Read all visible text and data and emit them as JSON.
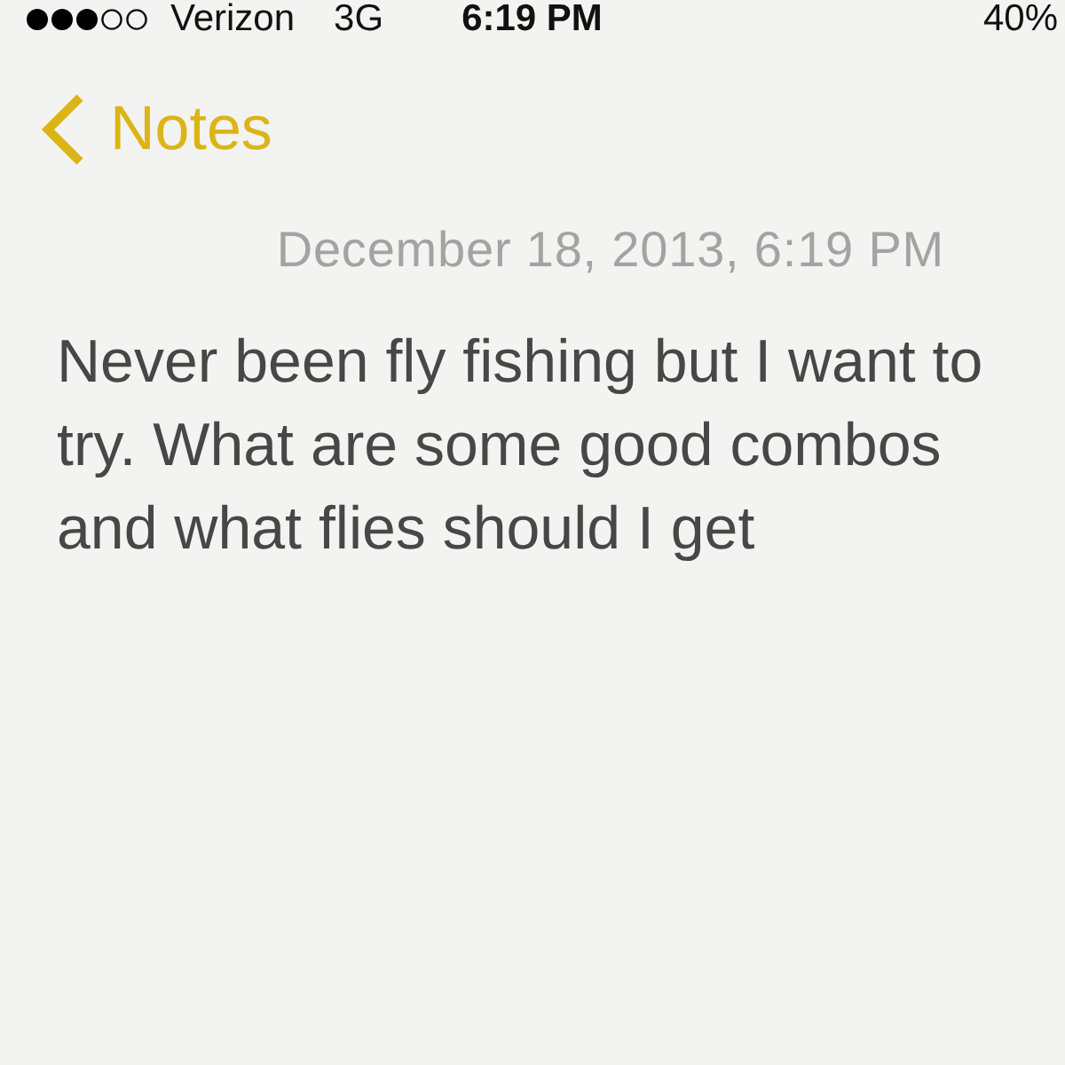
{
  "status_bar": {
    "carrier": "Verizon",
    "network": "3G",
    "time": "6:19 PM",
    "battery": "40%"
  },
  "nav": {
    "back_label": "Notes"
  },
  "note": {
    "date": "December 18, 2013, 6:19 PM",
    "body": "Never been fly fishing but I want to try. What are some good combos and what flies should I get"
  }
}
